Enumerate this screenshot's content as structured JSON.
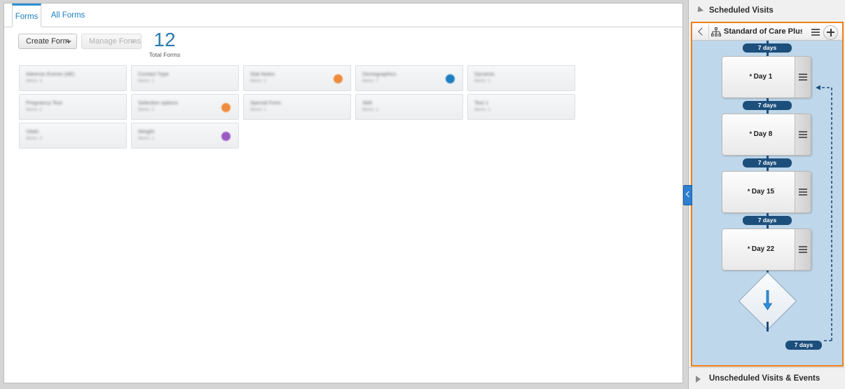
{
  "tabs": [
    {
      "label": "Forms",
      "active": true
    },
    {
      "label": "All Forms",
      "active": false
    }
  ],
  "toolbar": {
    "create_form_label": "Create Form",
    "manage_forms_label": "Manage Forms",
    "total_count": "12",
    "total_label": "Total Forms"
  },
  "forms": {
    "cards": [
      {
        "title": "Adverse Events (AE)",
        "subtitle": "Items: 4",
        "dot": null
      },
      {
        "title": "Contact Type",
        "subtitle": "Items: 1",
        "dot": null
      },
      {
        "title": "Stat Notes",
        "subtitle": "Items: 2",
        "dot": "#ef8b3c"
      },
      {
        "title": "Demographics",
        "subtitle": "Items: 7",
        "dot": "#1d7ec0"
      },
      {
        "title": "Dynamic",
        "subtitle": "Items: 1",
        "dot": null
      },
      {
        "title": "Pregnancy Test",
        "subtitle": "Items: 2",
        "dot": null
      },
      {
        "title": "Selection options",
        "subtitle": "Items: 2",
        "dot": "#ef8b3c"
      },
      {
        "title": "Special Form",
        "subtitle": "Items: 1",
        "dot": null
      },
      {
        "title": "Skill",
        "subtitle": "Items: 1",
        "dot": null
      },
      {
        "title": "Test 1",
        "subtitle": "Items: 1",
        "dot": null
      },
      {
        "title": "Vitals",
        "subtitle": "Items: 3",
        "dot": null
      },
      {
        "title": "Weight",
        "subtitle": "Items: 1",
        "dot": "#9b59c4"
      }
    ]
  },
  "right_panel": {
    "scheduled_section": {
      "title": "Scheduled Visits",
      "expanded": true
    },
    "unscheduled_section": {
      "title": "Unscheduled Visits & Events",
      "expanded": false
    },
    "diagram": {
      "title": "Standard of Care Plus A...",
      "back_label": "Back",
      "menu_label": "Menu",
      "add_label": "Add",
      "nodes": [
        {
          "type": "interval",
          "label": "7 days"
        },
        {
          "type": "visit",
          "label": "Day 1",
          "required_marker": "*"
        },
        {
          "type": "interval",
          "label": "7 days"
        },
        {
          "type": "visit",
          "label": "Day 8",
          "required_marker": "*"
        },
        {
          "type": "interval",
          "label": "7 days"
        },
        {
          "type": "visit",
          "label": "Day 15",
          "required_marker": "*"
        },
        {
          "type": "interval",
          "label": "7 days"
        },
        {
          "type": "visit",
          "label": "Day 22",
          "required_marker": "*"
        },
        {
          "type": "decision",
          "label": ""
        },
        {
          "type": "loop_interval",
          "label": "7 days"
        }
      ]
    }
  },
  "collapse_handle": {
    "label": "Collapse panel"
  },
  "colors": {
    "accent_blue": "#2d8fd5",
    "spine_navy": "#1d4f7c",
    "canvas_blue": "#bfd7ea",
    "highlight_orange": "#f07f15",
    "link_blue": "#1a7fc1"
  }
}
